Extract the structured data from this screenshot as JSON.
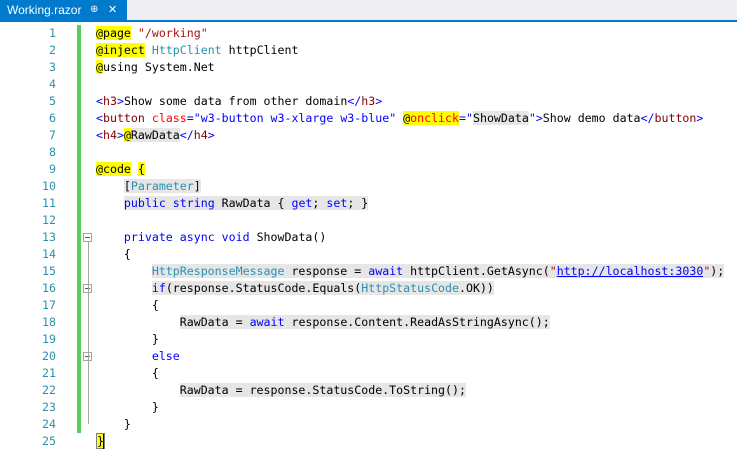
{
  "tab": {
    "title": "Working.razor",
    "pin": "⊕",
    "close": "✕"
  },
  "lines": [
    {
      "n": "1",
      "parts": [
        {
          "t": "@page",
          "c": "hl"
        },
        {
          "t": " ",
          "c": ""
        },
        {
          "t": "\"/working\"",
          "c": "st"
        }
      ]
    },
    {
      "n": "2",
      "parts": [
        {
          "t": "@inject",
          "c": "hl"
        },
        {
          "t": " ",
          "c": ""
        },
        {
          "t": "HttpClient",
          "c": "ty"
        },
        {
          "t": " httpClient",
          "c": ""
        }
      ]
    },
    {
      "n": "3",
      "parts": [
        {
          "t": "@",
          "c": "hl"
        },
        {
          "t": "using System.Net",
          "c": ""
        }
      ]
    },
    {
      "n": "4",
      "parts": []
    },
    {
      "n": "5",
      "parts": [
        {
          "t": "<",
          "c": "bl"
        },
        {
          "t": "h3",
          "c": "tag"
        },
        {
          "t": ">",
          "c": "bl"
        },
        {
          "t": "Show some data from other domain",
          "c": ""
        },
        {
          "t": "</",
          "c": "bl"
        },
        {
          "t": "h3",
          "c": "tag"
        },
        {
          "t": ">",
          "c": "bl"
        }
      ]
    },
    {
      "n": "6",
      "parts": [
        {
          "t": "<",
          "c": "bl"
        },
        {
          "t": "button",
          "c": "tag"
        },
        {
          "t": " ",
          "c": ""
        },
        {
          "t": "class",
          "c": "at"
        },
        {
          "t": "=",
          "c": "bl"
        },
        {
          "t": "\"w3-button w3-xlarge w3-blue\"",
          "c": "bl"
        },
        {
          "t": " ",
          "c": ""
        },
        {
          "t": "@",
          "c": "hl"
        },
        {
          "t": "onclick",
          "c": "at hl"
        },
        {
          "t": "=",
          "c": "bl"
        },
        {
          "t": "\"",
          "c": "bl"
        },
        {
          "t": "ShowData",
          "c": "sl"
        },
        {
          "t": "\"",
          "c": "bl"
        },
        {
          "t": ">",
          "c": "bl"
        },
        {
          "t": "Show demo data",
          "c": ""
        },
        {
          "t": "</",
          "c": "bl"
        },
        {
          "t": "button",
          "c": "tag"
        },
        {
          "t": ">",
          "c": "bl"
        }
      ]
    },
    {
      "n": "7",
      "parts": [
        {
          "t": "<",
          "c": "bl"
        },
        {
          "t": "h4",
          "c": "tag"
        },
        {
          "t": ">",
          "c": "bl"
        },
        {
          "t": "@",
          "c": "hl"
        },
        {
          "t": "RawData",
          "c": "sl"
        },
        {
          "t": "</",
          "c": "bl"
        },
        {
          "t": "h4",
          "c": "tag"
        },
        {
          "t": ">",
          "c": "bl"
        }
      ]
    },
    {
      "n": "8",
      "parts": []
    },
    {
      "n": "9",
      "parts": [
        {
          "t": "@code",
          "c": "hl"
        },
        {
          "t": " ",
          "c": ""
        },
        {
          "t": "{",
          "c": "hl"
        }
      ]
    },
    {
      "n": "10",
      "parts": [
        {
          "t": "    ",
          "c": ""
        },
        {
          "t": "[",
          "c": "sl"
        },
        {
          "t": "Parameter",
          "c": "ty sl"
        },
        {
          "t": "]",
          "c": "sl"
        }
      ]
    },
    {
      "n": "11",
      "parts": [
        {
          "t": "    ",
          "c": ""
        },
        {
          "t": "public string RawData { get; set; }",
          "c": "sl",
          "kw": [
            [
              "public",
              "bl"
            ],
            [
              "string",
              "bl"
            ],
            [
              "get",
              "bl"
            ],
            [
              "set",
              "bl"
            ]
          ]
        }
      ]
    },
    {
      "n": "12",
      "parts": []
    },
    {
      "n": "13",
      "parts": [
        {
          "t": "    ",
          "c": ""
        },
        {
          "t": "private async void ShowData()",
          "c": "",
          "kw": [
            [
              "private",
              "bl"
            ],
            [
              "async",
              "bl"
            ],
            [
              "void",
              "bl"
            ]
          ]
        }
      ]
    },
    {
      "n": "14",
      "parts": [
        {
          "t": "    {",
          "c": ""
        }
      ]
    },
    {
      "n": "15",
      "parts": [
        {
          "t": "        ",
          "c": ""
        },
        {
          "t": "HttpResponseMessage",
          "c": "ty sl"
        },
        {
          "t": " response = ",
          "c": "sl"
        },
        {
          "t": "await",
          "c": "bl sl"
        },
        {
          "t": " httpClient.GetAsync(",
          "c": "sl"
        },
        {
          "t": "\"",
          "c": "st sl"
        },
        {
          "t": "http://localhost:3030",
          "c": "ul sl"
        },
        {
          "t": "\"",
          "c": "st sl"
        },
        {
          "t": ");",
          "c": "sl"
        }
      ]
    },
    {
      "n": "16",
      "parts": [
        {
          "t": "        ",
          "c": ""
        },
        {
          "t": "if(response.StatusCode.Equals(",
          "c": "sl",
          "kw": [
            [
              "if",
              "bl"
            ]
          ]
        },
        {
          "t": "HttpStatusCode",
          "c": "ty sl"
        },
        {
          "t": ".OK))",
          "c": "sl"
        }
      ]
    },
    {
      "n": "17",
      "parts": [
        {
          "t": "        {",
          "c": ""
        }
      ]
    },
    {
      "n": "18",
      "parts": [
        {
          "t": "            ",
          "c": ""
        },
        {
          "t": "RawData = ",
          "c": "sl"
        },
        {
          "t": "await",
          "c": "bl sl"
        },
        {
          "t": " response.Content.ReadAsStringAsync();",
          "c": "sl"
        }
      ]
    },
    {
      "n": "19",
      "parts": [
        {
          "t": "        }",
          "c": ""
        }
      ]
    },
    {
      "n": "20",
      "parts": [
        {
          "t": "        ",
          "c": ""
        },
        {
          "t": "else",
          "c": "bl"
        }
      ]
    },
    {
      "n": "21",
      "parts": [
        {
          "t": "        {",
          "c": ""
        }
      ]
    },
    {
      "n": "22",
      "parts": [
        {
          "t": "            ",
          "c": ""
        },
        {
          "t": "RawData = response.StatusCode.ToString();",
          "c": "sl"
        }
      ]
    },
    {
      "n": "23",
      "parts": [
        {
          "t": "        }",
          "c": ""
        }
      ]
    },
    {
      "n": "24",
      "parts": [
        {
          "t": "    }",
          "c": ""
        }
      ]
    },
    {
      "n": "25",
      "parts": [
        {
          "t": "}",
          "c": "bm"
        }
      ]
    }
  ],
  "changed_lines": [
    "1",
    "2",
    "3",
    "4",
    "5",
    "6",
    "7",
    "8",
    "9",
    "10",
    "11",
    "12",
    "13",
    "14",
    "15",
    "16",
    "17",
    "18",
    "19",
    "20",
    "21",
    "22",
    "23",
    "24"
  ],
  "fold_markers": [
    "13",
    "16",
    "20"
  ],
  "colors": {
    "accent": "#007acc",
    "line_number": "#2b91af",
    "keyword": "#0000ff",
    "razor_highlight": "#ffff00",
    "change_bar": "#57cf57"
  }
}
